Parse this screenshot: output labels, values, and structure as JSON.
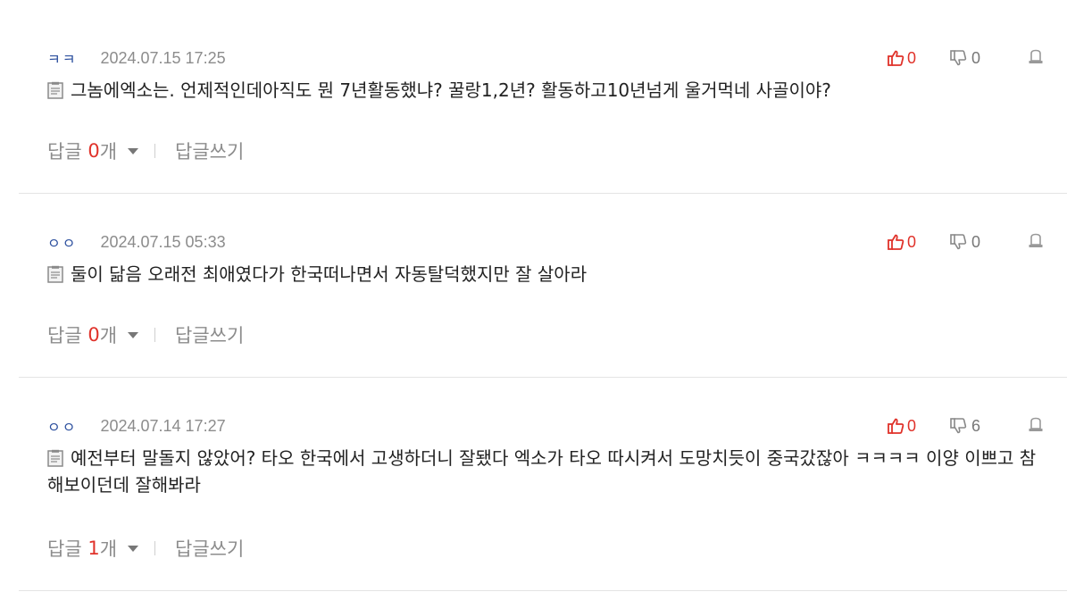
{
  "comments": [
    {
      "author": "ㅋㅋ",
      "date": "2024.07.15 17:25",
      "likes": "0",
      "dislikes": "0",
      "text": "그놈에엑소는. 언제적인데아직도 뭔 7년활동했냐? 꿀랑1,2년? 활동하고10년넘게 울거먹네 사골이야?",
      "reply_label": "답글",
      "reply_count": "0",
      "reply_unit": "개",
      "write_reply": "답글쓰기"
    },
    {
      "author": "ㅇㅇ",
      "date": "2024.07.15 05:33",
      "likes": "0",
      "dislikes": "0",
      "text": "둘이 닮음 오래전 최애였다가 한국떠나면서 자동탈덕했지만 잘 살아라",
      "reply_label": "답글",
      "reply_count": "0",
      "reply_unit": "개",
      "write_reply": "답글쓰기"
    },
    {
      "author": "ㅇㅇ",
      "date": "2024.07.14 17:27",
      "likes": "0",
      "dislikes": "6",
      "text": "예전부터 말돌지 않았어? 타오 한국에서 고생하더니 잘됐다 엑소가 타오 따시켜서 도망치듯이 중국갔잖아 ㅋㅋㅋㅋ 이양 이쁘고 참해보이던데 잘해봐라",
      "reply_label": "답글",
      "reply_count": "1",
      "reply_unit": "개",
      "write_reply": "답글쓰기"
    }
  ],
  "icons": {
    "like": "thumbs-up-icon",
    "dislike": "thumbs-down-icon",
    "report": "report-icon",
    "memo": "memo-icon",
    "caret": "caret-down-icon"
  },
  "colors": {
    "author": "#2c4f9e",
    "like_count": "#e0322a",
    "reply_count": "#e0322a",
    "muted": "#8c8c8c"
  }
}
